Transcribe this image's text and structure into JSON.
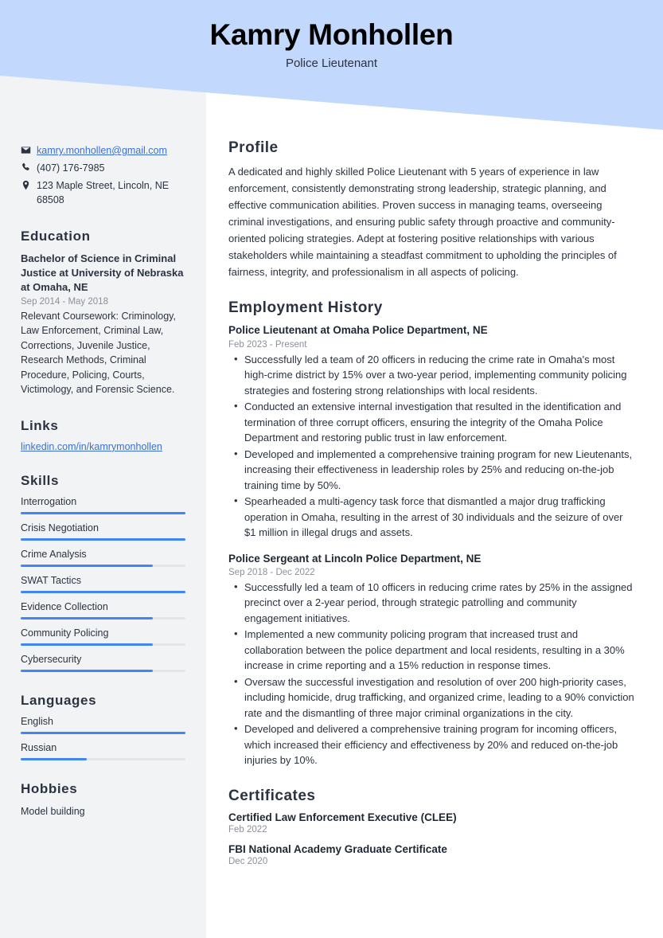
{
  "header": {
    "name": "Kamry Monhollen",
    "title": "Police Lieutenant",
    "banner_color": "#c2d8fd",
    "sidebar_color": "#f2f3f5"
  },
  "contact": {
    "email": "kamry.monhollen@gmail.com",
    "phone": "(407) 176-7985",
    "address": "123 Maple Street, Lincoln, NE 68508",
    "icons": [
      "envelope-icon",
      "phone-icon",
      "location-pin-icon"
    ]
  },
  "education": {
    "heading": "Education",
    "entries": [
      {
        "degree": "Bachelor of Science in Criminal Justice at University of Nebraska at Omaha, NE",
        "date": "Sep 2014 - May 2018",
        "description": "Relevant Coursework: Criminology, Law Enforcement, Criminal Law, Corrections, Juvenile Justice, Research Methods, Criminal Procedure, Policing, Courts, Victimology, and Forensic Science."
      }
    ]
  },
  "links": {
    "heading": "Links",
    "items": [
      {
        "label": "linkedin.com/in/kamrymonhollen"
      }
    ]
  },
  "skills": {
    "heading": "Skills",
    "accent_color": "#4285f4",
    "track_color": "#e3e5e8",
    "items": [
      {
        "label": "Interrogation",
        "level": 100
      },
      {
        "label": "Crisis Negotiation",
        "level": 100
      },
      {
        "label": "Crime Analysis",
        "level": 80
      },
      {
        "label": "SWAT Tactics",
        "level": 100
      },
      {
        "label": "Evidence Collection",
        "level": 80
      },
      {
        "label": "Community Policing",
        "level": 80
      },
      {
        "label": "Cybersecurity",
        "level": 80
      }
    ]
  },
  "languages": {
    "heading": "Languages",
    "items": [
      {
        "label": "English",
        "level": 100
      },
      {
        "label": "Russian",
        "level": 40
      }
    ]
  },
  "hobbies": {
    "heading": "Hobbies",
    "items": [
      {
        "label": "Model building"
      }
    ]
  },
  "profile": {
    "heading": "Profile",
    "text": "A dedicated and highly skilled Police Lieutenant with 5 years of experience in law enforcement, consistently demonstrating strong leadership, strategic planning, and effective communication abilities. Proven success in managing teams, overseeing criminal investigations, and ensuring public safety through proactive and community-oriented policing strategies. Adept at fostering positive relationships with various stakeholders while maintaining a steadfast commitment to upholding the principles of fairness, integrity, and professionalism in all aspects of policing."
  },
  "employment": {
    "heading": "Employment History",
    "jobs": [
      {
        "title": "Police Lieutenant at Omaha Police Department, NE",
        "date": "Feb 2023 - Present",
        "bullets": [
          "Successfully led a team of 20 officers in reducing the crime rate in Omaha's most high-crime district by 15% over a two-year period, implementing community policing strategies and fostering strong relationships with local residents.",
          "Conducted an extensive internal investigation that resulted in the identification and termination of three corrupt officers, ensuring the integrity of the Omaha Police Department and restoring public trust in law enforcement.",
          "Developed and implemented a comprehensive training program for new Lieutenants, increasing their effectiveness in leadership roles by 25% and reducing on-the-job training time by 50%.",
          "Spearheaded a multi-agency task force that dismantled a major drug trafficking operation in Omaha, resulting in the arrest of 30 individuals and the seizure of over $1 million in illegal drugs and assets."
        ]
      },
      {
        "title": "Police Sergeant at Lincoln Police Department, NE",
        "date": "Sep 2018 - Dec 2022",
        "bullets": [
          "Successfully led a team of 10 officers in reducing crime rates by 25% in the assigned precinct over a 2-year period, through strategic patrolling and community engagement initiatives.",
          "Implemented a new community policing program that increased trust and collaboration between the police department and local residents, resulting in a 30% increase in crime reporting and a 15% reduction in response times.",
          "Oversaw the successful investigation and resolution of over 200 high-priority cases, including homicide, drug trafficking, and organized crime, leading to a 90% conviction rate and the dismantling of three major criminal organizations in the city.",
          "Developed and delivered a comprehensive training program for incoming officers, which increased their efficiency and effectiveness by 20% and reduced on-the-job injuries by 10%."
        ]
      }
    ]
  },
  "certificates": {
    "heading": "Certificates",
    "items": [
      {
        "name": "Certified Law Enforcement Executive (CLEE)",
        "date": "Feb 2022"
      },
      {
        "name": "FBI National Academy Graduate Certificate",
        "date": "Dec 2020"
      }
    ]
  }
}
